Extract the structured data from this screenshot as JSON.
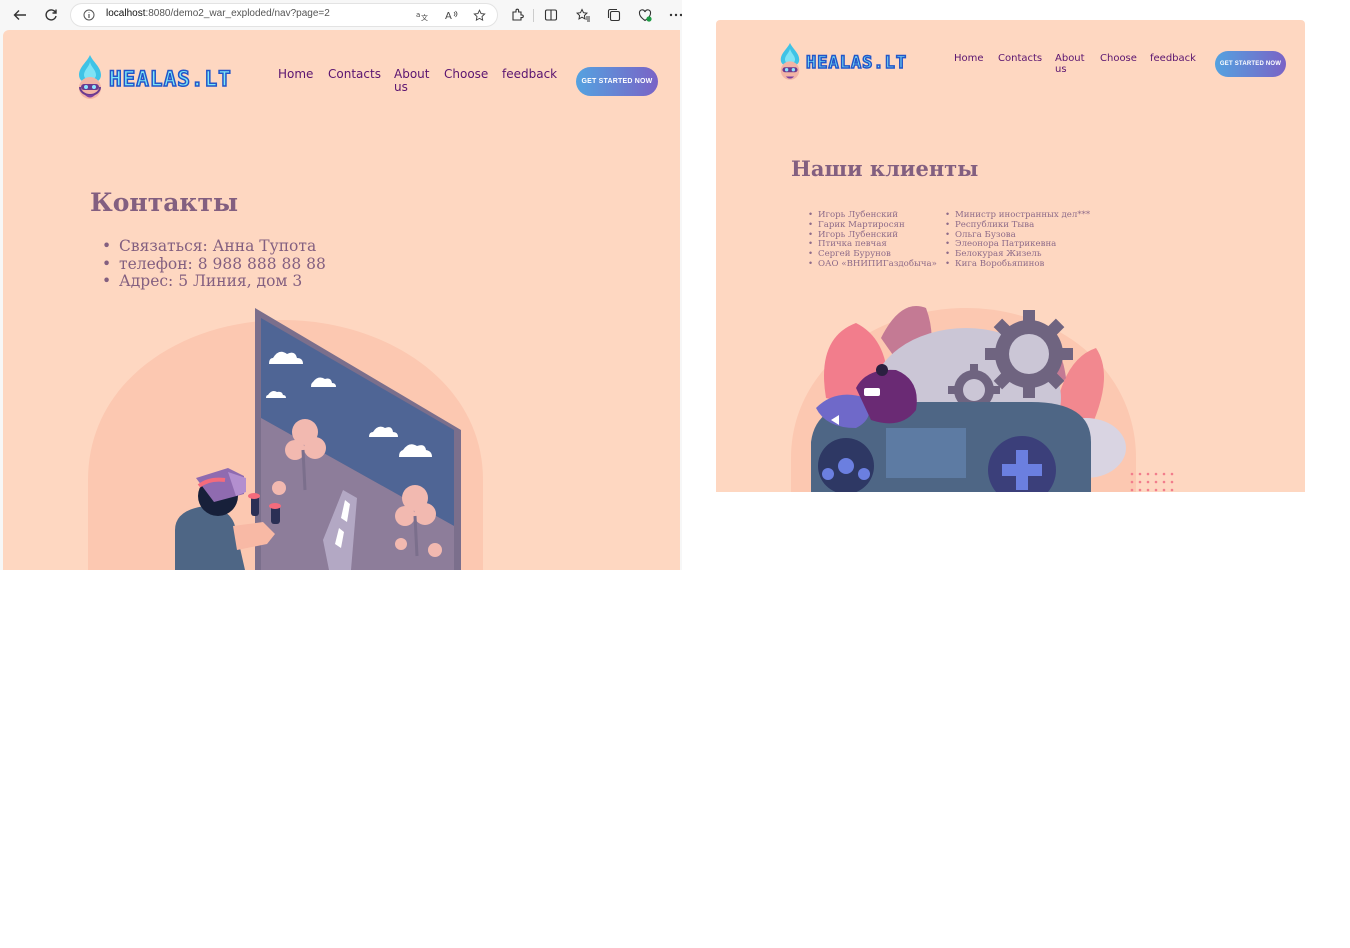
{
  "browser": {
    "url_host": "localhost",
    "url_path": ":8080/demo2_war_exploded/nav?page=2",
    "icons": [
      "back-arrow-icon",
      "reload-icon",
      "info-icon",
      "translate-icon",
      "read-aloud-icon",
      "favorite-star-icon",
      "extensions-icon",
      "split-screen-icon",
      "favorites-icon",
      "collections-icon",
      "browser-essentials-icon",
      "more-icon"
    ]
  },
  "site": {
    "logo_text": "HEALAS.LT",
    "nav": {
      "home": "Home",
      "contacts": "Contacts",
      "about_line1": "About",
      "about_line2": "us",
      "choose": "Choose",
      "feedback": "feedback"
    },
    "cta": "GET STARTED NOW",
    "colors": {
      "background": "#fed7c1",
      "heading": "#835f80",
      "nav": "#5a1470",
      "cta_from": "#54a2e0",
      "cta_to": "#7a63c6"
    }
  },
  "contacts_page": {
    "title": "Контакты",
    "items": [
      "Связаться: Анна Тупота",
      "телефон: 8 988 888 88 88",
      "Адрес: 5 Линия, дом 3"
    ]
  },
  "clients_page": {
    "title": "Наши клиенты",
    "col1": [
      "Игорь Лубенский",
      "Гарик Мартиросян",
      "Игорь Лубенский",
      "Птичка певчая",
      "Сергей Бурунов",
      "ОАО «ВНИПИГаздобыча»"
    ],
    "col2": [
      "Министр иностранных дел***",
      "Республики Тыва",
      "Ольга Бузова",
      "Элеонора Патрикевна",
      "Белокурая Жизель",
      "Кига Воробьяпинов"
    ]
  }
}
